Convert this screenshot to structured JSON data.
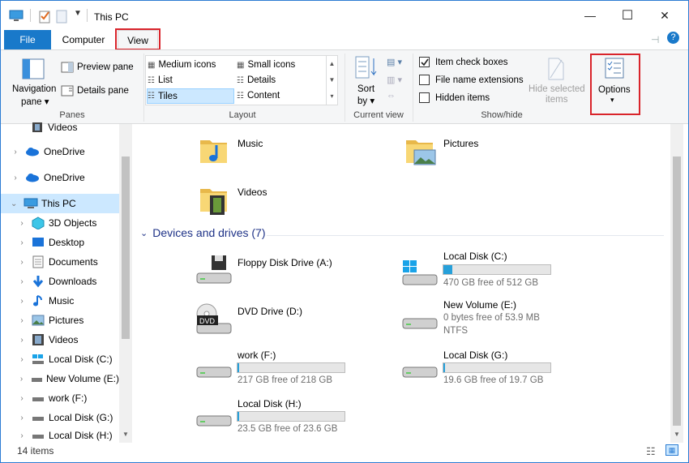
{
  "window": {
    "title": "This PC",
    "minimize": "—",
    "maximize": "☐",
    "close": "✕"
  },
  "tabs": {
    "file": "File",
    "computer": "Computer",
    "view": "View"
  },
  "ribbon": {
    "panes": {
      "navigation": "Navigation",
      "navigation2": "pane",
      "preview": "Preview pane",
      "details": "Details pane",
      "group": "Panes"
    },
    "layout": {
      "medium": "Medium icons",
      "small": "Small icons",
      "list": "List",
      "details": "Details",
      "tiles": "Tiles",
      "content": "Content",
      "group": "Layout"
    },
    "current_view": {
      "sort": "Sort",
      "sort2": "by",
      "group": "Current view"
    },
    "show_hide": {
      "item_check": "Item check boxes",
      "file_ext": "File name extensions",
      "hidden": "Hidden items",
      "hide_selected": "Hide selected",
      "hide_selected2": "items",
      "group": "Show/hide"
    },
    "options": {
      "label": "Options"
    }
  },
  "nav": {
    "items": [
      {
        "label": "Videos"
      },
      {
        "label": "OneDrive"
      },
      {
        "label": "OneDrive"
      },
      {
        "label": "This PC"
      },
      {
        "label": "3D Objects"
      },
      {
        "label": "Desktop"
      },
      {
        "label": "Documents"
      },
      {
        "label": "Downloads"
      },
      {
        "label": "Music"
      },
      {
        "label": "Pictures"
      },
      {
        "label": "Videos"
      },
      {
        "label": "Local Disk (C:)"
      },
      {
        "label": "New Volume (E:)"
      },
      {
        "label": "work (F:)"
      },
      {
        "label": "Local Disk (G:)"
      },
      {
        "label": "Local Disk (H:)"
      }
    ]
  },
  "folders": [
    {
      "name": "Music"
    },
    {
      "name": "Pictures"
    },
    {
      "name": "Videos"
    }
  ],
  "devices": {
    "header": "Devices and drives (7)",
    "items": [
      {
        "name": "Floppy Disk Drive (A:)"
      },
      {
        "name": "Local Disk (C:)",
        "free": "470 GB free of 512 GB",
        "used_fraction": 0.08
      },
      {
        "name": "DVD Drive (D:)",
        "badge": "DVD"
      },
      {
        "name": "New Volume (E:)",
        "free": "0 bytes free of 53.9 MB",
        "fs": "NTFS"
      },
      {
        "name": "work (F:)",
        "free": "217 GB free of 218 GB",
        "used_fraction": 0.005
      },
      {
        "name": "Local Disk (G:)",
        "free": "19.6 GB free of 19.7 GB",
        "used_fraction": 0.005
      },
      {
        "name": "Local Disk (H:)",
        "free": "23.5 GB free of 23.6 GB",
        "used_fraction": 0.004
      }
    ]
  },
  "status": {
    "count": "14 items"
  },
  "colors": {
    "accent": "#1979ca",
    "highlight": "#d9242b",
    "selected": "#cce8ff",
    "folder": "#f8d775"
  }
}
